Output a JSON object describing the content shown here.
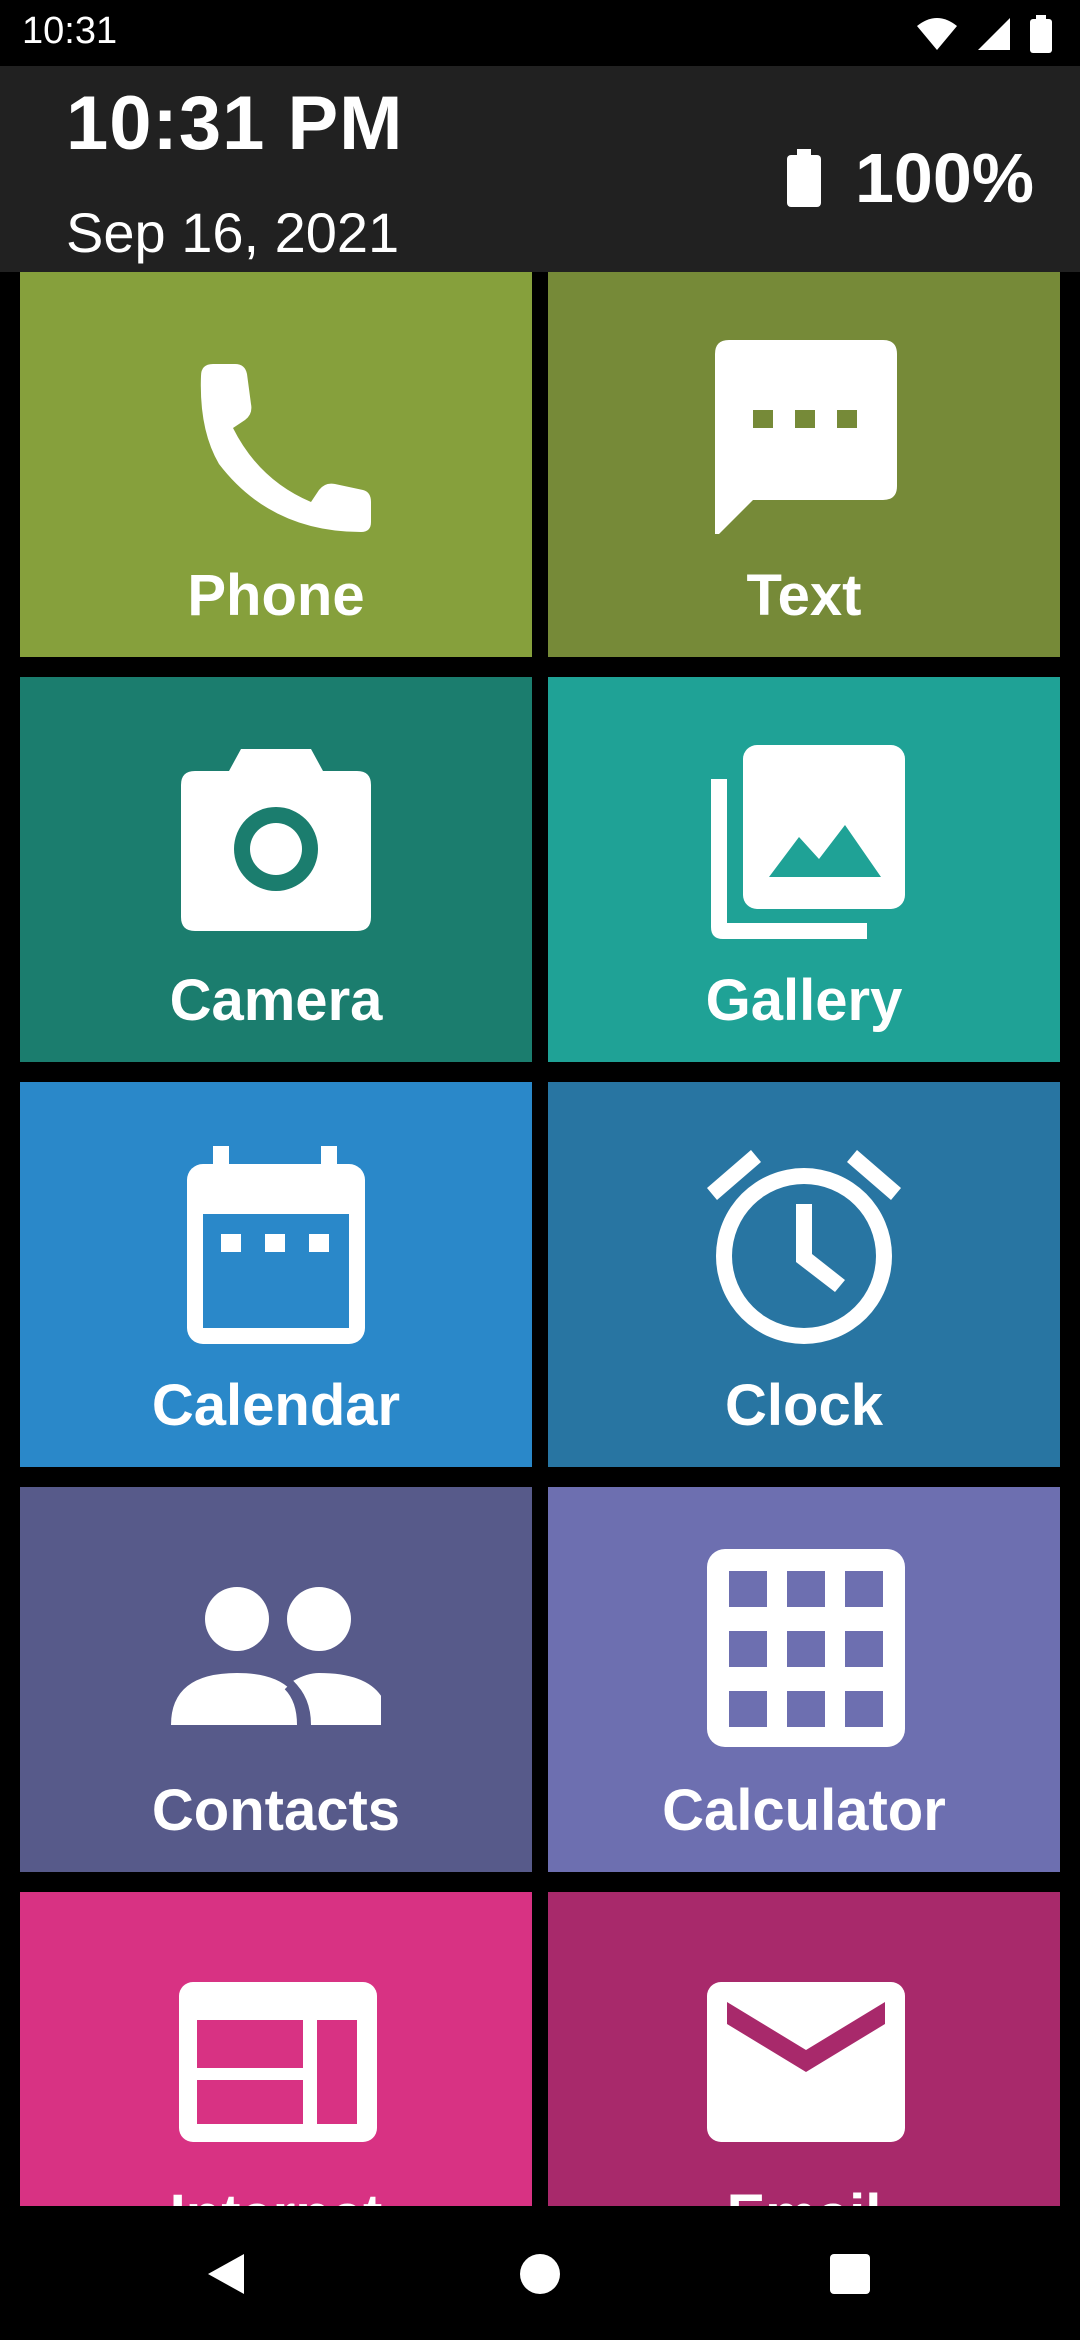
{
  "status_bar": {
    "time": "10:31"
  },
  "header": {
    "time": "10:31 PM",
    "date": "Sep 16, 2021",
    "battery": "100%"
  },
  "tiles": [
    {
      "label": "Phone",
      "color": "#86A03C",
      "icon": "phone-icon"
    },
    {
      "label": "Text",
      "color": "#768A38",
      "icon": "message-icon"
    },
    {
      "label": "Camera",
      "color": "#1B7D6E",
      "icon": "camera-icon"
    },
    {
      "label": "Gallery",
      "color": "#1FA296",
      "icon": "gallery-icon"
    },
    {
      "label": "Calendar",
      "color": "#2A88C9",
      "icon": "calendar-icon"
    },
    {
      "label": "Clock",
      "color": "#2875A2",
      "icon": "alarm-clock-icon"
    },
    {
      "label": "Contacts",
      "color": "#575A8A",
      "icon": "contacts-icon"
    },
    {
      "label": "Calculator",
      "color": "#6D6FB0",
      "icon": "calculator-icon"
    },
    {
      "label": "Internet",
      "color": "#D83283",
      "icon": "browser-icon"
    },
    {
      "label": "Email",
      "color": "#A8296B",
      "icon": "email-icon"
    }
  ],
  "nav": {
    "back": "back-icon",
    "home": "home-icon",
    "recents": "recents-icon"
  }
}
